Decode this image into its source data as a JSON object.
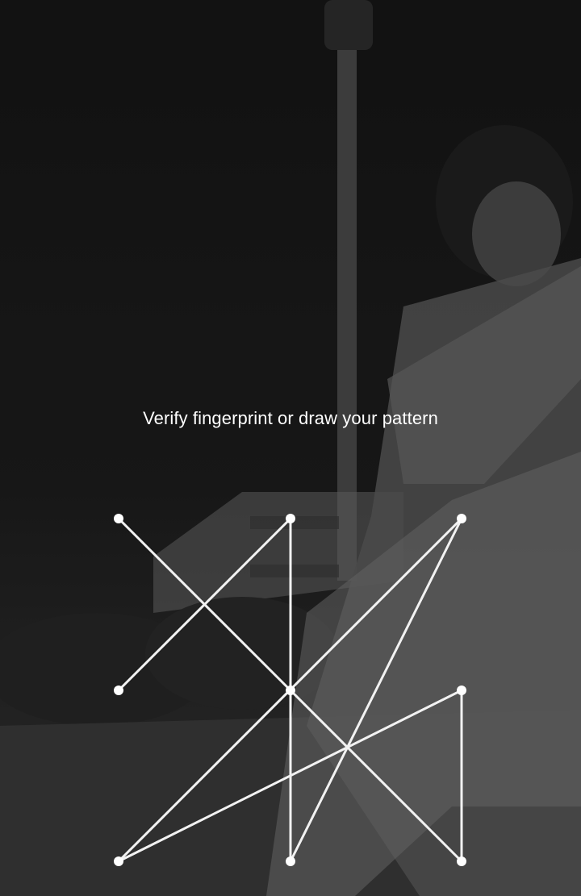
{
  "lockscreen": {
    "prompt": "Verify fingerprint or draw your pattern",
    "pattern": {
      "grid_size": 3,
      "sequence": [
        1,
        5,
        9,
        6,
        7,
        3,
        8,
        2,
        4
      ]
    }
  },
  "colors": {
    "text": "#ffffff",
    "pattern_line": "#f2f2f2",
    "pattern_dot": "#ffffff"
  }
}
